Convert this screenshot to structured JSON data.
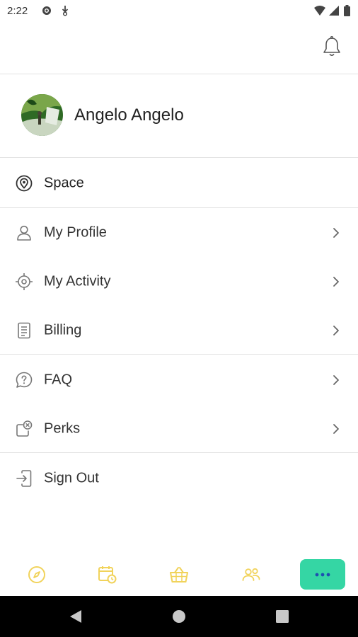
{
  "status_bar": {
    "time": "2:22"
  },
  "profile": {
    "name": "Angelo Angelo"
  },
  "menu": {
    "space": "Space",
    "my_profile": "My Profile",
    "my_activity": "My Activity",
    "billing": "Billing",
    "faq": "FAQ",
    "perks": "Perks",
    "sign_out": "Sign Out"
  },
  "bottom_nav": {
    "items": [
      "compass-icon",
      "calendar-clock-icon",
      "basket-icon",
      "people-icon",
      "more-icon"
    ],
    "active": "more-icon",
    "accent_color": "#35d6a4",
    "icon_color": "#f1d35b"
  }
}
